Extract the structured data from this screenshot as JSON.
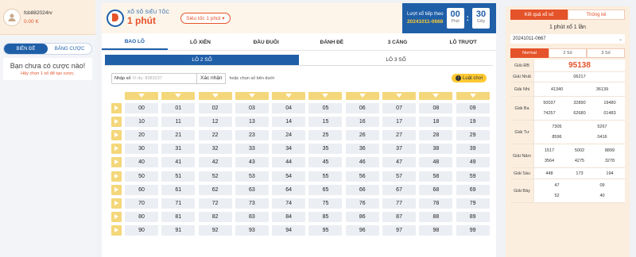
{
  "user": {
    "name": "fcb882024rv",
    "balance": "0.00 K"
  },
  "bet_tabs": [
    "BIÊN ĐỀ",
    "BẢNG CƯỢC"
  ],
  "no_bet": {
    "title": "Bạn chưa có cược nào!",
    "subtitle": "Hãy chọn 1 số để tạo cược."
  },
  "brand": {
    "line1": "XỔ SỐ SIÊU TỐC",
    "line2": "1 phút"
  },
  "speed_select": "Siêu tốc 1 phút ▾",
  "timer": {
    "label": "Lượt xổ tiếp theo",
    "draw_id": "20241011-0668",
    "minutes": "00",
    "minutes_unit": "Phút",
    "seconds": "30",
    "seconds_unit": "Giây"
  },
  "nav": [
    "BAO LÔ",
    "LÔ XIÊN",
    "ĐẦU ĐUÔI",
    "ĐÁNH ĐỀ",
    "3 CÀNG",
    "LÔ TRƯỢT"
  ],
  "sub_tabs": [
    "LÔ 2 SỐ",
    "LÔ 3 SỐ"
  ],
  "input": {
    "label": "Nhập số",
    "placeholder": "Ví dụ: 8383237",
    "confirm": "Xác nhận",
    "or_select": "hoặc chọn số bên dưới",
    "rules": "Luật chơi"
  },
  "numbers": [
    [
      "00",
      "01",
      "02",
      "03",
      "04",
      "05",
      "06",
      "07",
      "08",
      "09"
    ],
    [
      "10",
      "11",
      "12",
      "13",
      "14",
      "15",
      "16",
      "17",
      "18",
      "19"
    ],
    [
      "20",
      "21",
      "22",
      "23",
      "24",
      "25",
      "26",
      "27",
      "28",
      "29"
    ],
    [
      "30",
      "31",
      "32",
      "33",
      "34",
      "35",
      "36",
      "37",
      "38",
      "39"
    ],
    [
      "40",
      "41",
      "42",
      "43",
      "44",
      "45",
      "46",
      "47",
      "48",
      "49"
    ],
    [
      "50",
      "51",
      "52",
      "53",
      "54",
      "55",
      "56",
      "57",
      "58",
      "59"
    ],
    [
      "60",
      "61",
      "62",
      "63",
      "64",
      "65",
      "66",
      "67",
      "68",
      "69"
    ],
    [
      "70",
      "71",
      "72",
      "73",
      "74",
      "75",
      "76",
      "77",
      "78",
      "79"
    ],
    [
      "80",
      "81",
      "82",
      "83",
      "84",
      "85",
      "86",
      "87",
      "88",
      "89"
    ],
    [
      "90",
      "91",
      "92",
      "93",
      "94",
      "95",
      "96",
      "97",
      "98",
      "99"
    ]
  ],
  "right_tabs": [
    "Kết quả xổ số",
    "Thống kê"
  ],
  "right_title": "1 phút xổ 1 lần",
  "right_select": "20241011-0667",
  "modes": [
    "Normal",
    "2 Số",
    "3 Số"
  ],
  "results": [
    {
      "label": "Giải ĐB",
      "values": [
        "95138"
      ],
      "special": true
    },
    {
      "label": "Giải Nhất",
      "values": [
        "06217"
      ]
    },
    {
      "label": "Giải Nhì",
      "values": [
        "41340",
        "36139"
      ]
    },
    {
      "label": "Giải Ba",
      "values": [
        "50037",
        "32890",
        "19480",
        "74257",
        "62680",
        "01483"
      ]
    },
    {
      "label": "Giải Tư",
      "values": [
        "7305",
        "5267",
        "8596",
        "0416"
      ]
    },
    {
      "label": "Giải Năm",
      "values": [
        "1517",
        "5002",
        "8899",
        "3564",
        "4275",
        "3278"
      ]
    },
    {
      "label": "Giải Sáu",
      "values": [
        "448",
        "173",
        "194"
      ]
    },
    {
      "label": "Giải Bảy",
      "values": [
        "47",
        "09",
        "52",
        "40"
      ]
    }
  ]
}
